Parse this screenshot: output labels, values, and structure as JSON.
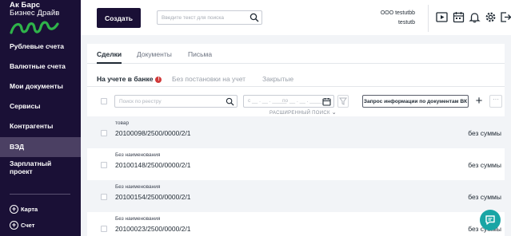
{
  "logo": {
    "line1": "Ак Барс",
    "line2": "Бизнес Драйв"
  },
  "sidebar": {
    "items": [
      {
        "label": "Рублевые счета"
      },
      {
        "label": "Валютные счета"
      },
      {
        "label": "Мои документы"
      },
      {
        "label": "Сервисы"
      },
      {
        "label": "Контрагенты"
      },
      {
        "label": "ВЭД"
      },
      {
        "label": "Зарплатный проект"
      }
    ],
    "active_index": 5,
    "actions": [
      {
        "label": "Карта"
      },
      {
        "label": "Счет"
      }
    ]
  },
  "header": {
    "create_label": "Создать",
    "search_placeholder": "Введите текст для поиска",
    "user_name": "ООО testutbb",
    "user_login": "testutb",
    "icons": [
      "play-icon",
      "calendar-icon",
      "bell-icon",
      "gear-icon",
      "logout-icon"
    ]
  },
  "tabs": [
    {
      "label": "Сделки"
    },
    {
      "label": "Документы"
    },
    {
      "label": "Письма"
    }
  ],
  "subtabs": [
    {
      "label": "На учете в банке",
      "badge": "!"
    },
    {
      "label": "Без постановки на учет"
    },
    {
      "label": "Закрытые"
    }
  ],
  "filters": {
    "search_placeholder": "Поиск по реестру",
    "date_from": "с __ . __ . _____",
    "date_to": "по __ . __ . _____",
    "request_label": "Запрос информации по документам ВК",
    "add_label": "+",
    "more_label": "···",
    "advanced_label": "РАСШИРЕННЫЙ ПОИСК"
  },
  "deals": [
    {
      "description": "товар",
      "number": "20100098/2500/0000/2/1",
      "amount": "без суммы"
    },
    {
      "description": "Без наименования",
      "number": "20100148/2500/0000/2/1",
      "amount": "без суммы"
    },
    {
      "description": "Без наименования",
      "number": "20100154/2500/0000/2/1",
      "amount": "без суммы"
    },
    {
      "description": "Без наименования",
      "number": "20100023/2500/0000/2/1",
      "amount": "без суммы"
    }
  ],
  "colors": {
    "sidebar": "#1a1036",
    "active_item": "#4b4063",
    "accent": "#19a5a5",
    "badge": "#d13a3a"
  }
}
